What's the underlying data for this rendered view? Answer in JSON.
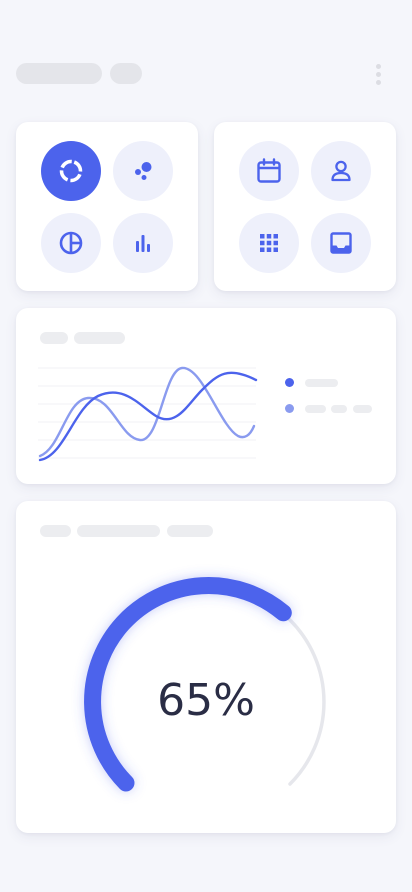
{
  "header": {
    "menu_icon": "more-vertical-icon"
  },
  "icon_grid_left": [
    {
      "icon": "donut-chart-icon",
      "active": true
    },
    {
      "icon": "bubble-chart-icon",
      "active": false
    },
    {
      "icon": "pie-chart-icon",
      "active": false
    },
    {
      "icon": "bar-chart-icon",
      "active": false
    }
  ],
  "icon_grid_right": [
    {
      "icon": "calendar-icon",
      "active": false
    },
    {
      "icon": "user-icon",
      "active": false
    },
    {
      "icon": "apps-grid-icon",
      "active": false
    },
    {
      "icon": "inbox-icon",
      "active": false
    }
  ],
  "colors": {
    "accent": "#4C63EC",
    "accent_light": "#8A9BEF",
    "icon_bg": "#EEF0FB",
    "track": "#E6E7EC",
    "text": "#2A2D45"
  },
  "gauge": {
    "value_label": "65%",
    "fraction": 0.65
  }
}
